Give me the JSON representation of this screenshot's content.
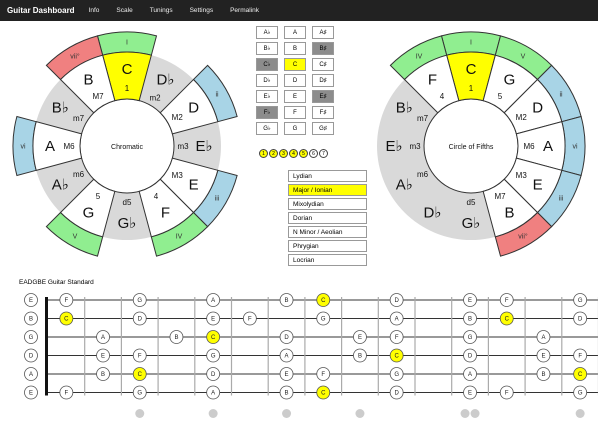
{
  "app_title": "Guitar Dashboard",
  "nav": [
    "Info",
    "Scale",
    "Tunings",
    "Settings",
    "Permalink"
  ],
  "colors": {
    "key": "#ffff00",
    "major": "#90ee90",
    "minor": "#a8d4e6",
    "dim": "#f08080",
    "ring": "#d9d9d9"
  },
  "chromatic": {
    "label": "Chromatic",
    "notes": [
      "C",
      "D♭",
      "D",
      "E♭",
      "E",
      "F",
      "G♭",
      "G",
      "A♭",
      "A",
      "B♭",
      "B"
    ],
    "intervals": [
      "1",
      "m2",
      "M2",
      "m3",
      "M3",
      "4",
      "d5",
      "5",
      "m6",
      "M6",
      "m7",
      "M7"
    ],
    "chords": [
      "I",
      "",
      "ii",
      "",
      "iii",
      "IV",
      "",
      "V",
      "",
      "vi",
      "",
      "vii°"
    ]
  },
  "fifths": {
    "label": "Circle of Fifths",
    "notes": [
      "C",
      "G",
      "D",
      "A",
      "E",
      "B",
      "G♭",
      "D♭",
      "A♭",
      "E♭",
      "B♭",
      "F"
    ],
    "intervals": [
      "1",
      "5",
      "M2",
      "M6",
      "M3",
      "M7",
      "d5",
      "",
      "m6",
      "m3",
      "m7",
      "4"
    ],
    "chords": [
      "I",
      "V",
      "ii",
      "vi",
      "iii",
      "vii°",
      "",
      "",
      "",
      "",
      "",
      "IV"
    ]
  },
  "key_grid": [
    [
      "A♭",
      "A",
      "A♯"
    ],
    [
      "B♭",
      "B",
      "B♯"
    ],
    [
      "C♭",
      "C",
      "C♯"
    ],
    [
      "D♭",
      "D",
      "D♯"
    ],
    [
      "E♭",
      "E",
      "E♯"
    ],
    [
      "F♭",
      "F",
      "F♯"
    ],
    [
      "G♭",
      "G",
      "G♯"
    ]
  ],
  "key_selected": "C",
  "key_disabled": [
    "B♯",
    "C♭",
    "E♯",
    "F♭"
  ],
  "degree_dots": [
    "1",
    "2",
    "3",
    "4",
    "5",
    "6",
    "7"
  ],
  "degree_dots_active": [
    1,
    2,
    3,
    4,
    5
  ],
  "modes": [
    "Lydian",
    "Major / Ionian",
    "Mixolydian",
    "Dorian",
    "N Minor / Aeolian",
    "Phrygian",
    "Locrian"
  ],
  "mode_selected": 1,
  "fretboard": {
    "title": "EADGBE Guitar Standard",
    "open_strings": [
      "E",
      "B",
      "G",
      "D",
      "A",
      "E"
    ],
    "rows": [
      [
        {
          "f": 1,
          "n": "F"
        },
        {
          "f": 3,
          "n": "G"
        },
        {
          "f": 5,
          "n": "A"
        },
        {
          "f": 7,
          "n": "B"
        },
        {
          "f": 8,
          "n": "C"
        },
        {
          "f": 10,
          "n": "D"
        },
        {
          "f": 12,
          "n": "E"
        },
        {
          "f": 13,
          "n": "F"
        },
        {
          "f": 15,
          "n": "G"
        }
      ],
      [
        {
          "f": 1,
          "n": "C"
        },
        {
          "f": 3,
          "n": "D"
        },
        {
          "f": 5,
          "n": "E"
        },
        {
          "f": 6,
          "n": "F"
        },
        {
          "f": 8,
          "n": "G"
        },
        {
          "f": 10,
          "n": "A"
        },
        {
          "f": 12,
          "n": "B"
        },
        {
          "f": 13,
          "n": "C"
        },
        {
          "f": 15,
          "n": "D"
        }
      ],
      [
        {
          "f": 2,
          "n": "A"
        },
        {
          "f": 4,
          "n": "B"
        },
        {
          "f": 5,
          "n": "C"
        },
        {
          "f": 7,
          "n": "D"
        },
        {
          "f": 9,
          "n": "E"
        },
        {
          "f": 10,
          "n": "F"
        },
        {
          "f": 12,
          "n": "G"
        },
        {
          "f": 14,
          "n": "A"
        },
        {
          "f": 16,
          "n": "B"
        }
      ],
      [
        {
          "f": 2,
          "n": "E"
        },
        {
          "f": 3,
          "n": "F"
        },
        {
          "f": 5,
          "n": "G"
        },
        {
          "f": 7,
          "n": "A"
        },
        {
          "f": 9,
          "n": "B"
        },
        {
          "f": 10,
          "n": "C"
        },
        {
          "f": 12,
          "n": "D"
        },
        {
          "f": 14,
          "n": "E"
        },
        {
          "f": 15,
          "n": "F"
        }
      ],
      [
        {
          "f": 2,
          "n": "B"
        },
        {
          "f": 3,
          "n": "C"
        },
        {
          "f": 5,
          "n": "D"
        },
        {
          "f": 7,
          "n": "E"
        },
        {
          "f": 8,
          "n": "F"
        },
        {
          "f": 10,
          "n": "G"
        },
        {
          "f": 12,
          "n": "A"
        },
        {
          "f": 14,
          "n": "B"
        },
        {
          "f": 15,
          "n": "C"
        }
      ],
      [
        {
          "f": 1,
          "n": "F"
        },
        {
          "f": 3,
          "n": "G"
        },
        {
          "f": 5,
          "n": "A"
        },
        {
          "f": 7,
          "n": "B"
        },
        {
          "f": 8,
          "n": "C"
        },
        {
          "f": 10,
          "n": "D"
        },
        {
          "f": 12,
          "n": "E"
        },
        {
          "f": 13,
          "n": "F"
        },
        {
          "f": 15,
          "n": "G"
        }
      ]
    ],
    "inlay_frets": [
      3,
      5,
      7,
      9,
      12,
      15
    ]
  }
}
